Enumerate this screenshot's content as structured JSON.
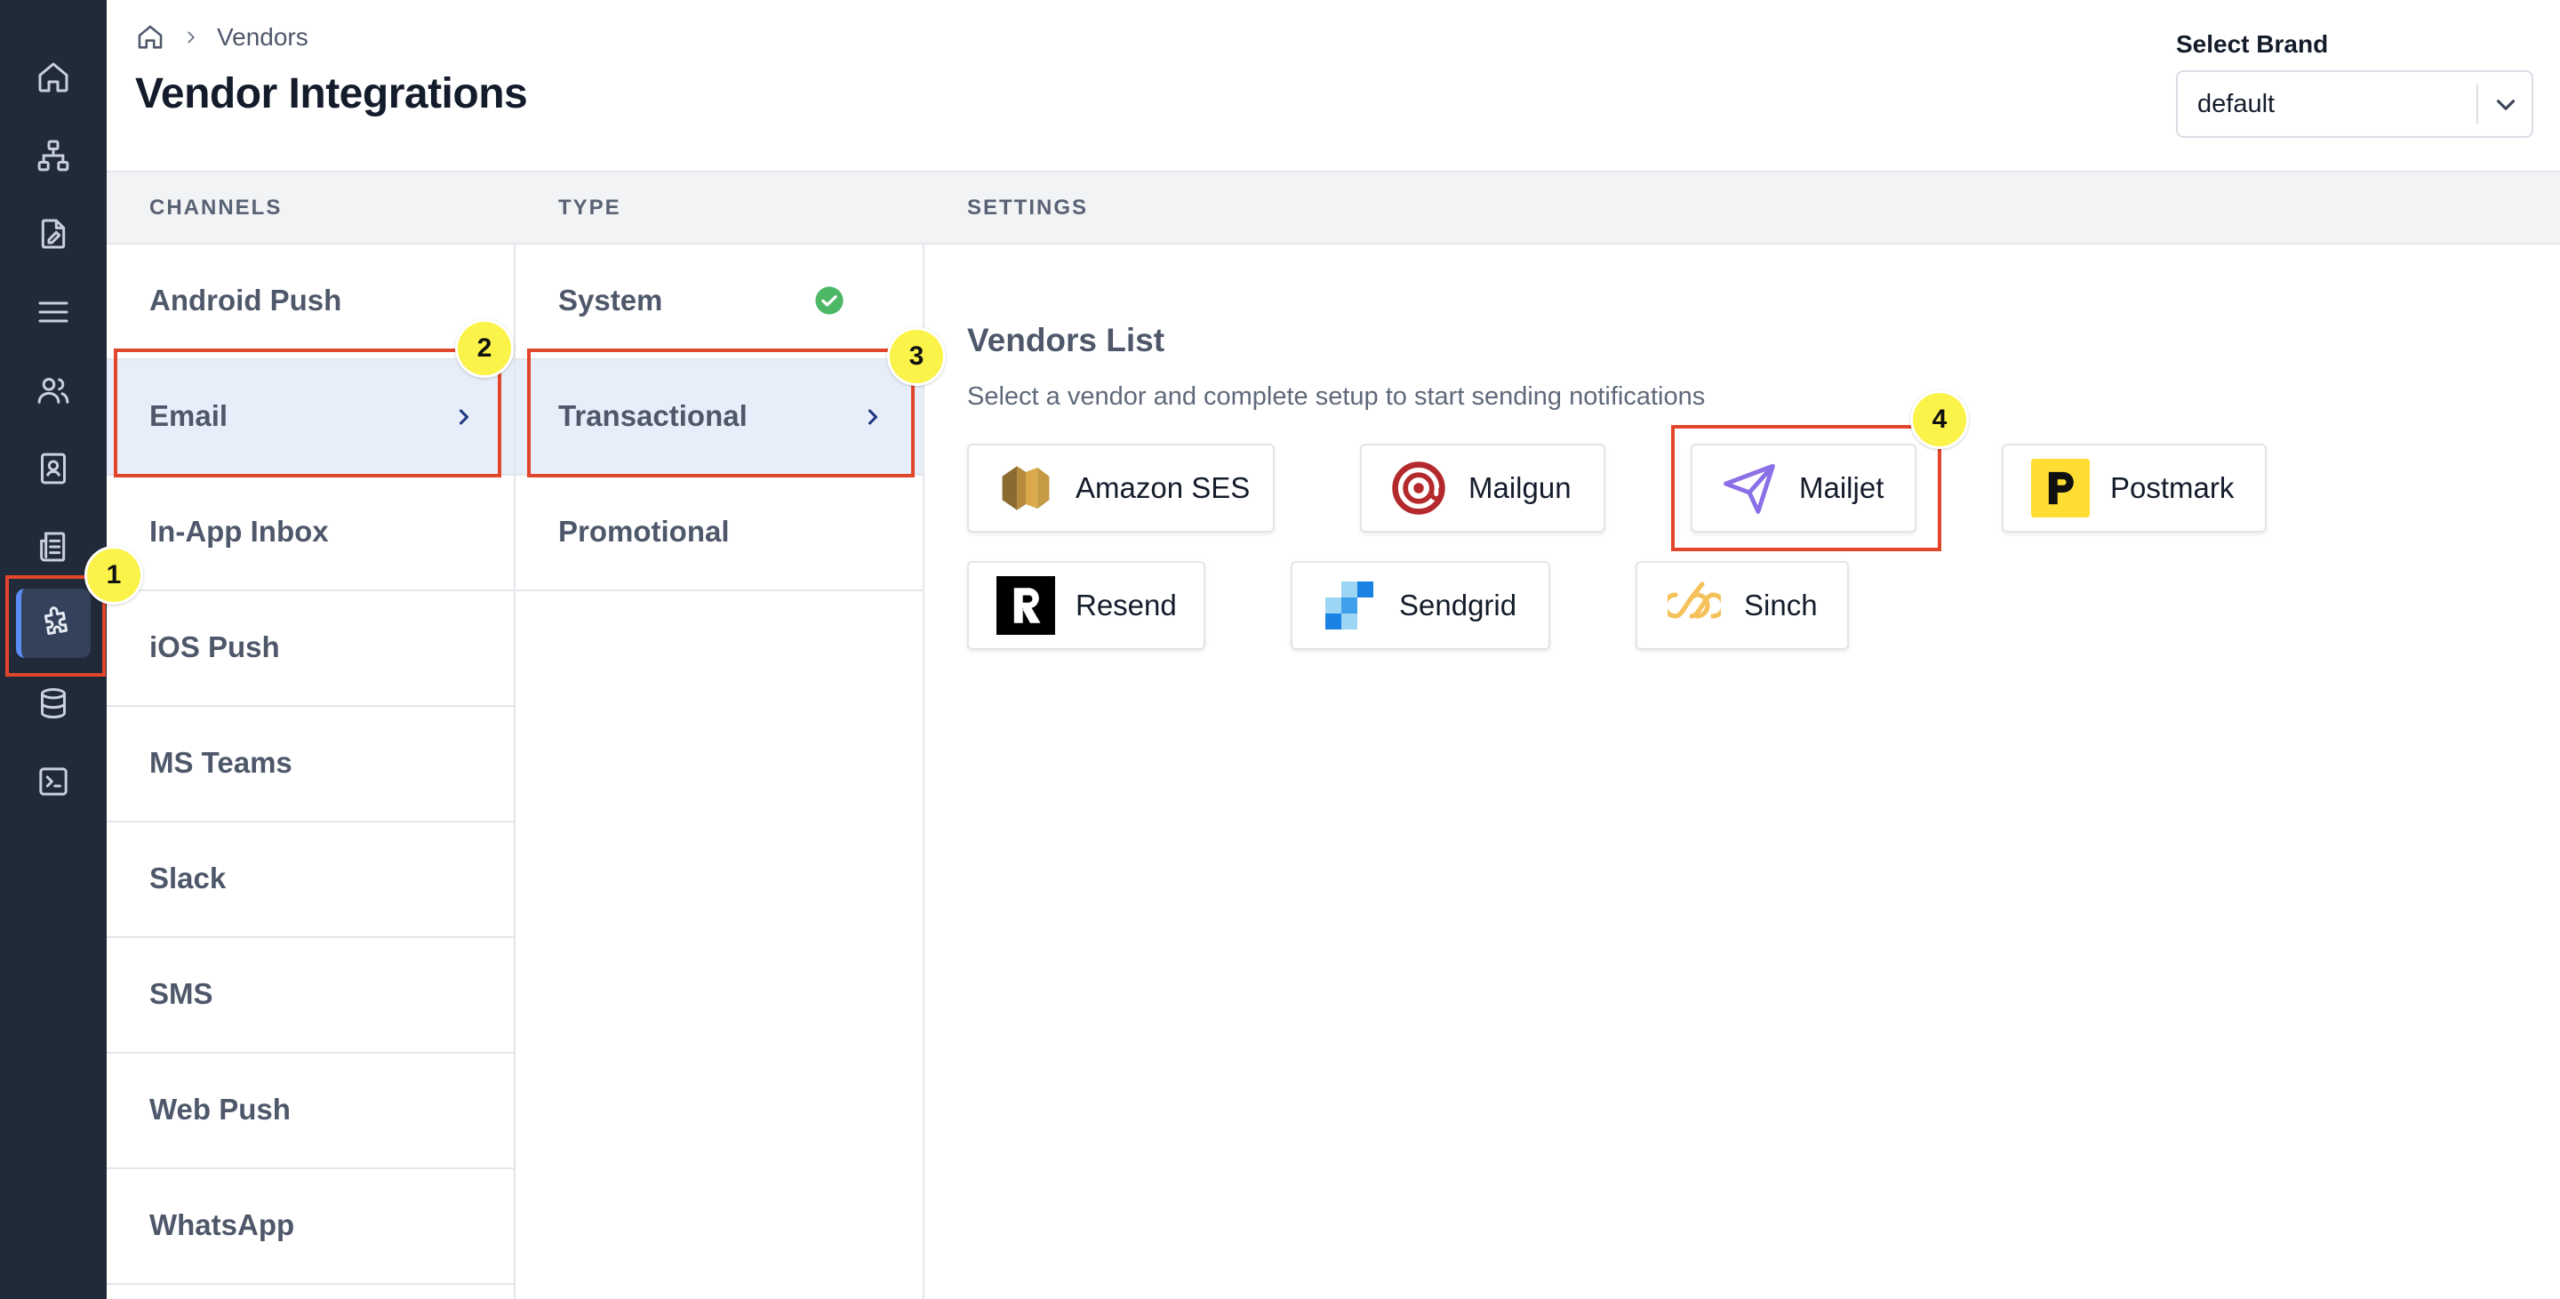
{
  "breadcrumb": {
    "current": "Vendors"
  },
  "page_title": "Vendor Integrations",
  "brand": {
    "label": "Select Brand",
    "value": "default"
  },
  "columns": {
    "channels": "CHANNELS",
    "type": "TYPE",
    "settings": "SETTINGS"
  },
  "sidebar": {
    "items": [
      "home-icon",
      "org-chart-icon",
      "file-edit-icon",
      "menu-icon",
      "users-icon",
      "contact-card-icon",
      "document-list-icon",
      "puzzle-icon",
      "database-icon",
      "terminal-icon"
    ],
    "active": "puzzle-icon",
    "accent": "#5b8bf5"
  },
  "channels": [
    "Android Push",
    "Email",
    "In-App Inbox",
    "iOS Push",
    "MS Teams",
    "Slack",
    "SMS",
    "Web Push",
    "WhatsApp"
  ],
  "channels_selected": "Email",
  "types": [
    "System",
    "Transactional",
    "Promotional"
  ],
  "types_selected": "Transactional",
  "vendors": {
    "title": "Vendors List",
    "subtitle": "Select a vendor and complete setup to start sending notifications",
    "items": [
      "Amazon SES",
      "Mailgun",
      "Mailjet",
      "Postmark",
      "Resend",
      "Sendgrid",
      "Sinch"
    ]
  },
  "annotations": {
    "badges": [
      "1",
      "2",
      "3",
      "4"
    ],
    "highlight_color": "#e2462a",
    "badge_color": "#fbf34a"
  }
}
